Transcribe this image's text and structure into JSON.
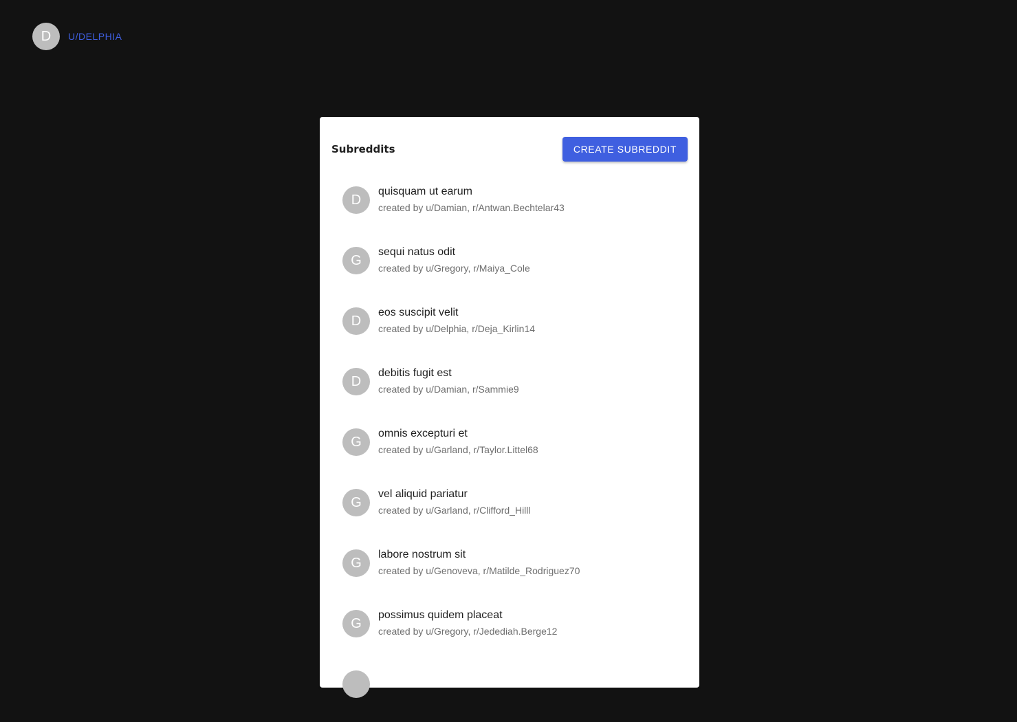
{
  "header": {
    "avatar_letter": "D",
    "username": "U/DELPHIA"
  },
  "card": {
    "title": "Subreddits",
    "create_button_label": "CREATE SUBREDDIT",
    "items": [
      {
        "avatar": "D",
        "name": "quisquam ut earum",
        "meta": "created by u/Damian, r/Antwan.Bechtelar43"
      },
      {
        "avatar": "G",
        "name": "sequi natus odit",
        "meta": "created by u/Gregory, r/Maiya_Cole"
      },
      {
        "avatar": "D",
        "name": "eos suscipit velit",
        "meta": "created by u/Delphia, r/Deja_Kirlin14"
      },
      {
        "avatar": "D",
        "name": "debitis fugit est",
        "meta": "created by u/Damian, r/Sammie9"
      },
      {
        "avatar": "G",
        "name": "omnis excepturi et",
        "meta": "created by u/Garland, r/Taylor.Littel68"
      },
      {
        "avatar": "G",
        "name": "vel aliquid pariatur",
        "meta": "created by u/Garland, r/Clifford_Hilll"
      },
      {
        "avatar": "G",
        "name": "labore nostrum sit",
        "meta": "created by u/Genoveva, r/Matilde_Rodriguez70"
      },
      {
        "avatar": "G",
        "name": "possimus quidem placeat",
        "meta": "created by u/Gregory, r/Jedediah.Berge12"
      }
    ]
  },
  "colors": {
    "background": "#121212",
    "accent": "#3f5fe0",
    "avatar": "#bdbdbd"
  }
}
